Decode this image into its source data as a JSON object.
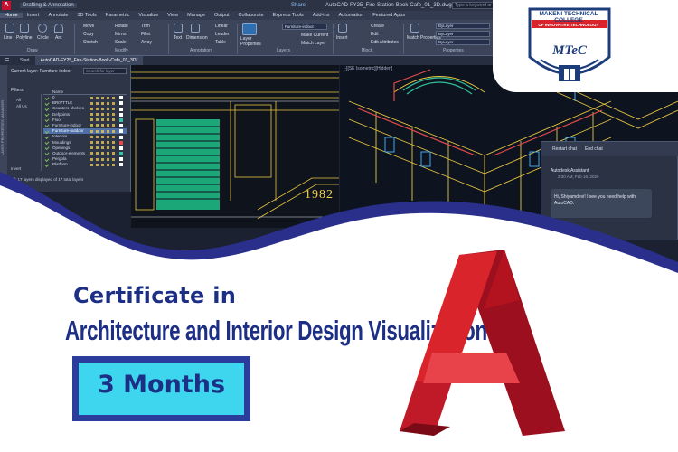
{
  "window": {
    "app_logo": "A",
    "workspace": "Drafting & Annotation",
    "share": "Share",
    "document_title": "AutoCAD-FY25_Fire-Station-Book-Cafe_01_3D.dwg",
    "search_placeholder": "Type a keyword or phrase"
  },
  "menu_tabs": [
    "Home",
    "Insert",
    "Annotate",
    "3D Tools",
    "Parametric",
    "Visualize",
    "View",
    "Manage",
    "Output",
    "Collaborate",
    "Express Tools",
    "Add-ins",
    "Automation",
    "Featured Apps"
  ],
  "ribbon": {
    "draw_tools": [
      "Line",
      "Polyline",
      "Circle",
      "Arc"
    ],
    "modify_tools": [
      "Move",
      "Rotate",
      "Trim",
      "Copy",
      "Mirror",
      "Fillet",
      "Stretch",
      "Scale",
      "Array"
    ],
    "annotation_tools": [
      "Text",
      "Dimension",
      "Linear",
      "Leader",
      "Table"
    ],
    "layer_tools": [
      "Layer Properties",
      "Make Current",
      "Match Layer"
    ],
    "current_layer": "Furniture-indoor",
    "block_tools": [
      "Insert",
      "Create",
      "Edit",
      "Edit Attributes"
    ],
    "properties_tools": [
      "Match Properties"
    ],
    "property_fields": [
      "ByLayer",
      "ByLayer",
      "ByLayer"
    ],
    "groups": [
      "Draw",
      "Modify",
      "Annotation",
      "Layers",
      "Block",
      "Properties"
    ]
  },
  "file_tabs": {
    "start": "Start",
    "active": "AutoCAD-FY25_Fire-Station-Book-Cafe_01_3D*"
  },
  "layer_panel": {
    "side_title": "LAYER PROPERTIES MANAGER",
    "current_layer_label": "Current layer: Furniture-indoor",
    "search_placeholder": "Search for layer",
    "filters_label": "Filters",
    "tree_items": [
      "All",
      "All Us"
    ],
    "column_header": "Name",
    "layers": [
      {
        "name": "0",
        "color": "#ffffff"
      },
      {
        "name": "BR07TTLE",
        "color": "#ffffff"
      },
      {
        "name": "Counters-shelves",
        "color": "#ffffff"
      },
      {
        "name": "Defpoints",
        "color": "#ffffff"
      },
      {
        "name": "Floor",
        "color": "#3cc1a6"
      },
      {
        "name": "Furniture-indoor",
        "color": "#ffffff"
      },
      {
        "name": "Furniture-outdoor",
        "color": "#ffffff"
      },
      {
        "name": "Interiors",
        "color": "#ffffff"
      },
      {
        "name": "Mouldings",
        "color": "#e24b4b"
      },
      {
        "name": "Openings",
        "color": "#ffffff"
      },
      {
        "name": "Outdoor-elements",
        "color": "#3cc1a6"
      },
      {
        "name": "Pergola",
        "color": "#ffffff"
      },
      {
        "name": "Platform",
        "color": "#ffffff"
      }
    ],
    "selected_index": 6,
    "invert_filter": "Invert",
    "footer": "All: 17 layers displayed of 17 total layers"
  },
  "viewport_right_label": "[-][SE Isometric][Hidden]",
  "drawing_year": "1982",
  "assistant": {
    "restart": "Restart chat",
    "end": "End chat",
    "name": "Autodesk Assistant",
    "time": "2:30 AM, Feb 16, 2026",
    "message": "Hi, Shiyamdevi! I see you need help with AutoCAD."
  },
  "logo": {
    "line1": "MAKENI TECHNICAL COLLEGE",
    "tagline": "OF INNOVATIVE TECHNOLOGY",
    "mark": "MTeC"
  },
  "promo": {
    "title_line1": "Certificate in",
    "title_line2": "Architecture and Interior Design Visualization",
    "duration": "3 Months"
  },
  "colors": {
    "navy": "#1d2f85",
    "cyan_box": "#3ed6ee",
    "autocad_red": "#c8102e",
    "wave_blue": "#2a2f8c"
  }
}
